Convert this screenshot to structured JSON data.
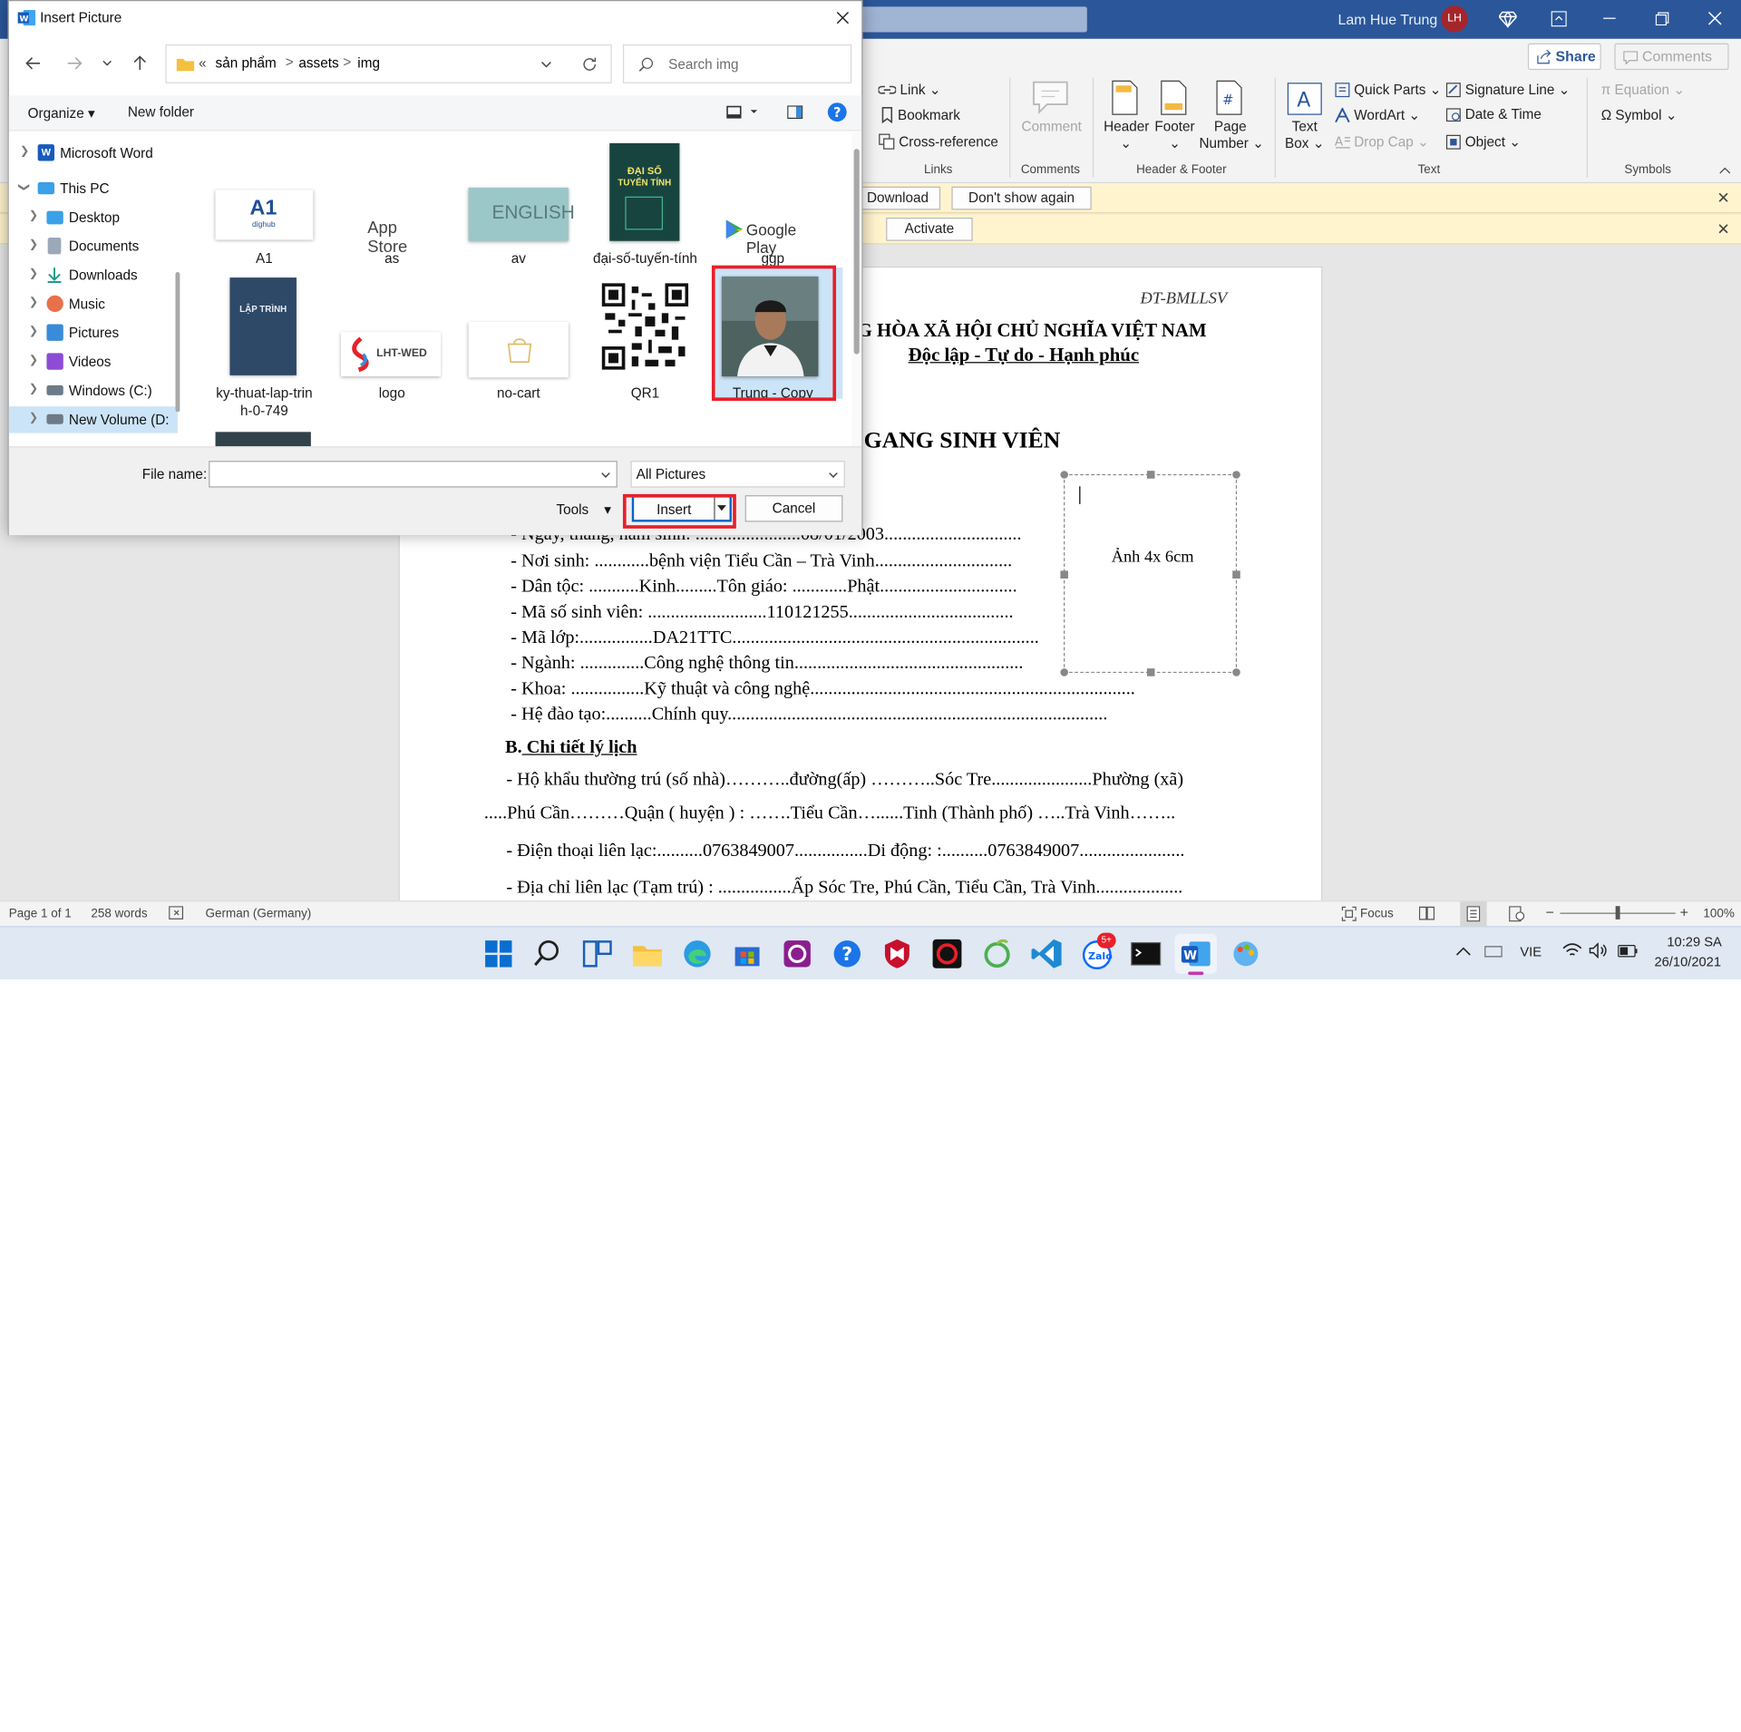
{
  "word": {
    "user_name": "Lam Hue Trung",
    "user_initials": "LH",
    "share_label": "Share",
    "comments_label": "Comments",
    "ribbon": {
      "link": "Link",
      "bookmark": "Bookmark",
      "cross_reference": "Cross-reference",
      "links_group": "Links",
      "comment": "Comment",
      "comments_group": "Comments",
      "header": "Header",
      "footer": "Footer",
      "page_number_1": "Page",
      "page_number_2": "Number",
      "header_footer_group": "Header & Footer",
      "text_box_1": "Text",
      "text_box_2": "Box",
      "quick_parts": "Quick Parts",
      "wordart": "WordArt",
      "drop_cap": "Drop Cap",
      "signature_line": "Signature Line",
      "date_time": "Date & Time",
      "object": "Object",
      "text_group": "Text",
      "equation": "Equation",
      "symbol": "Symbol",
      "symbols_group": "Symbols"
    },
    "message_bars": {
      "download": "Download",
      "dont_show": "Don't show again",
      "activate": "Activate"
    },
    "document": {
      "code": "ĐT-BMLLSV",
      "republic": "NG HÒA XÃ HỘI CHỦ NGHĨA VIỆT NAM",
      "motto": "Độc lập - Tự do - Hạnh phúc",
      "heading": "GANG SINH VIÊN",
      "photo_caption": "Ảnh 4x 6cm",
      "lines": [
        "- Ngày, tháng, năm sinh: .......................08/01/2003..............................",
        "- Nơi sinh: ............bệnh viện Tiểu Cần – Trà Vinh..............................",
        "- Dân tộc: ...........Kinh.........Tôn giáo: ............Phật..............................",
        "- Mã số sinh viên: ..........................110121255....................................",
        "- Mã lớp:................DA21TTC...................................................................",
        "- Ngành: ..............Công nghệ thông tin..................................................",
        "- Khoa: ................Kỹ thuật và công nghệ.......................................................................",
        "- Hệ đào tạo:..........Chính quy..................................................................................."
      ],
      "section_b_prefix": "B.",
      "section_b_title": " Chi tiết lý lịch",
      "addr_line1": "- Hộ khẩu thường trú (số nhà)………..đường(ấp) ………..Sóc Tre......................Phường (xã)",
      "addr_line2": ".....Phú Cần………Quận ( huyện ) : …….Tiểu Cần…......Tinh (Thành phố) …..Trà Vinh……..",
      "phone_line": "- Điện thoại liên lạc:..........0763849007................Di động: :..........0763849007.......................",
      "contact_line": "- Địa chỉ liên lạc (Tạm trú) : ................Ấp Sóc Tre, Phú Cần, Tiểu Cần, Trà Vinh..................."
    },
    "status": {
      "page": "Page 1 of 1",
      "words": "258 words",
      "language": "German (Germany)",
      "focus": "Focus",
      "zoom": "100%"
    }
  },
  "taskbar": {
    "language": "VIE",
    "time": "10:29 SA",
    "date": "26/10/2021",
    "zalo_badge": "5+"
  },
  "dialog": {
    "title": "Insert Picture",
    "breadcrumb": [
      "«",
      "sản phẩm",
      ">",
      "assets",
      ">",
      "img"
    ],
    "search_placeholder": "Search img",
    "organize": "Organize",
    "new_folder": "New folder",
    "nav_items": [
      "Microsoft Word",
      "This PC",
      "Desktop",
      "Documents",
      "Downloads",
      "Music",
      "Pictures",
      "Videos",
      "Windows (C:)",
      "New Volume (D:"
    ],
    "files": [
      {
        "name": "A1"
      },
      {
        "name": "as"
      },
      {
        "name": "av"
      },
      {
        "name": "đại-số-tuyến-tính"
      },
      {
        "name": "ggp"
      },
      {
        "name": "ky-thuat-lap-trin"
      },
      {
        "name": "logo"
      },
      {
        "name": "no-cart"
      },
      {
        "name": "QR1"
      },
      {
        "name": "Trung - Copy"
      }
    ],
    "file_name_line2": "h-0-749",
    "thumb_text": {
      "a1": "A1",
      "a1_sub": "dighub",
      "app_store": "App Store",
      "english": "ENGLISH",
      "daiso_1": "ĐẠI SỐ",
      "daiso_2": "TUYẾN TÍNH",
      "google_play": "Google Play",
      "laptrinh": "LẬP TRÌNH",
      "lht": "LHT-WED"
    },
    "file_name_label": "File name:",
    "file_name_value": "",
    "file_type": "All Pictures",
    "tools": "Tools",
    "insert": "Insert",
    "cancel": "Cancel"
  }
}
